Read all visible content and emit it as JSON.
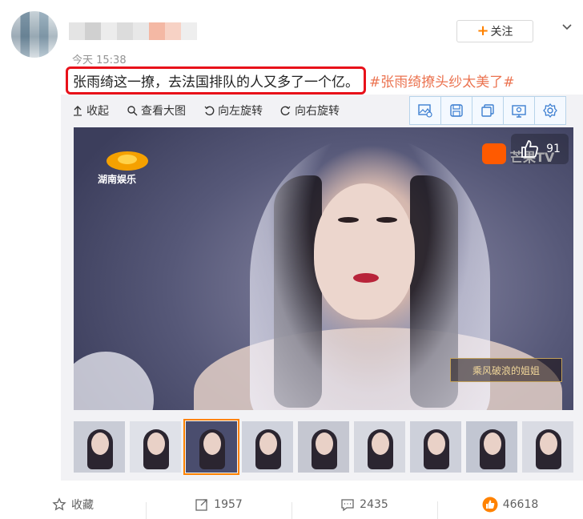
{
  "post": {
    "time": "今天 15:38",
    "text_main": "张雨绮这一撩，去法国排队的人又多了一个亿。",
    "hashtag": "#张雨绮撩头纱太美了#",
    "follow_label": "关注"
  },
  "toolbar": {
    "collapse": "收起",
    "view_large": "查看大图",
    "rotate_left": "向左旋转",
    "rotate_right": "向右旋转"
  },
  "tool_icons": [
    "image-search-icon",
    "save-icon",
    "copy-icon",
    "image-edit-icon",
    "settings-icon"
  ],
  "media": {
    "likes": "91",
    "channel_logo_text": "湖南娱乐",
    "watermark_text": "芒果TV",
    "show_badge_text": "乘风破浪的姐姐"
  },
  "thumbnails": [
    {
      "selected": false,
      "bg": "#c9ccd6"
    },
    {
      "selected": false,
      "bg": "#dfe1e8"
    },
    {
      "selected": true,
      "bg": "#4a4d6e"
    },
    {
      "selected": false,
      "bg": "#cfd2dc"
    },
    {
      "selected": false,
      "bg": "#c5c7d1"
    },
    {
      "selected": false,
      "bg": "#d6d8e0"
    },
    {
      "selected": false,
      "bg": "#cdd0da"
    },
    {
      "selected": false,
      "bg": "#c2c6d2"
    },
    {
      "selected": false,
      "bg": "#d9dbe3"
    }
  ],
  "footer": {
    "favorite": "收藏",
    "repost_count": "1957",
    "comment_count": "2435",
    "like_count": "46618"
  },
  "colors": {
    "accent": "#ff8200",
    "hashtag": "#eb7350",
    "highlight_border": "#e8111a"
  }
}
